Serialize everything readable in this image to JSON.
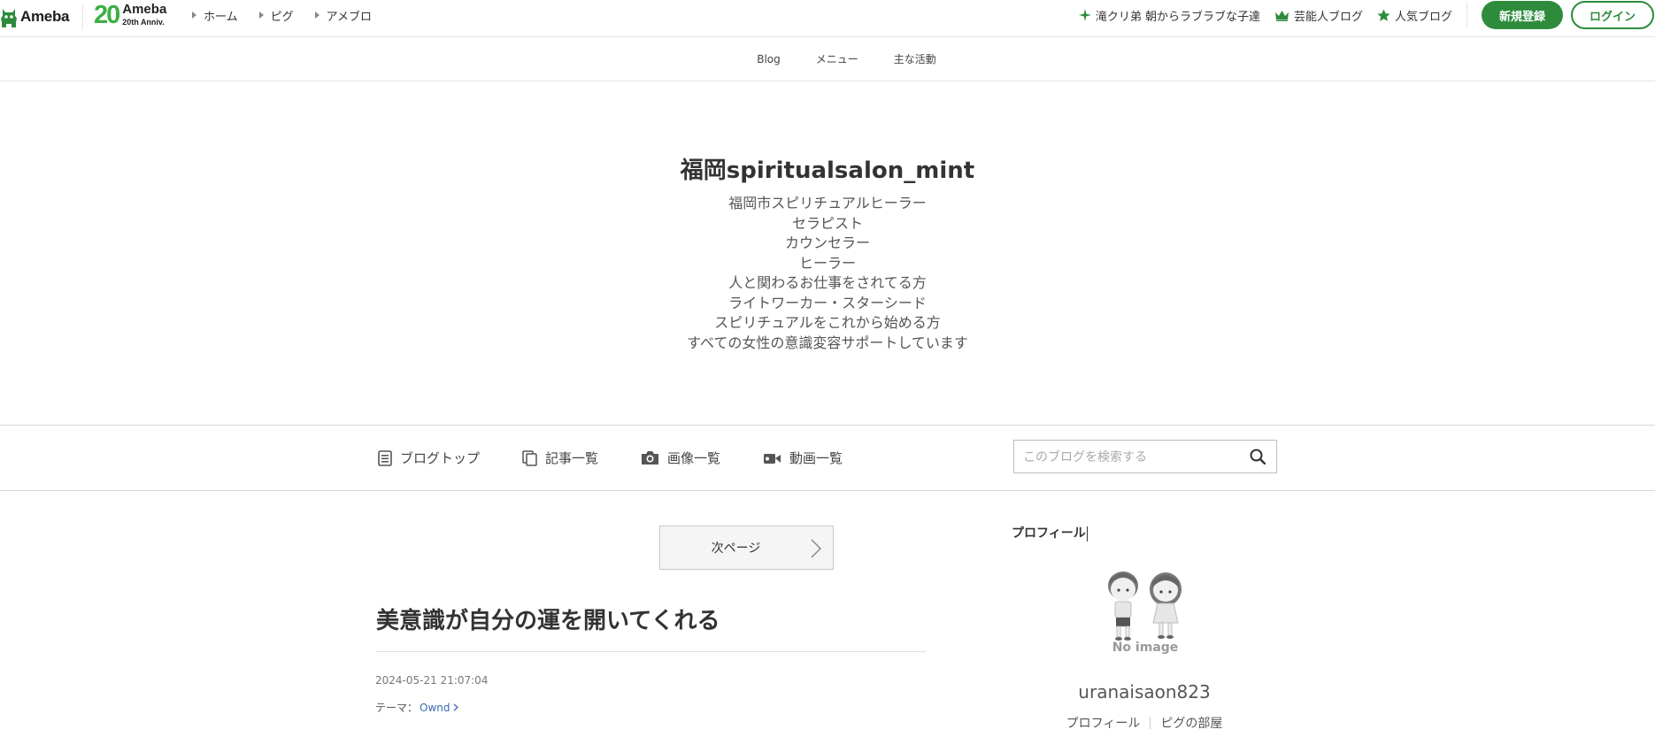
{
  "global_header": {
    "logo_text": "Ameba",
    "anniversary": {
      "number": "20",
      "brand": "Ameba",
      "label": "20th Anniv."
    },
    "nav": [
      {
        "label": "ホーム"
      },
      {
        "label": "ピグ"
      },
      {
        "label": "アメブロ"
      }
    ],
    "featured": [
      {
        "icon": "sparkle-icon",
        "label": "滝クリ弟 朝からラブラブな子達"
      },
      {
        "icon": "crown-icon",
        "label": "芸能人ブログ"
      },
      {
        "icon": "star-icon",
        "label": "人気ブログ"
      }
    ],
    "register_label": "新規登録",
    "login_label": "ログイン",
    "brand_color": "#2d8c3c"
  },
  "blog_nav": {
    "items": [
      {
        "label": "Blog"
      },
      {
        "label": "メニュー"
      },
      {
        "label": "主な活動"
      }
    ]
  },
  "blog_header": {
    "title": "福岡spiritualsalon_mint",
    "description": [
      "福岡市スピリチュアルヒーラー",
      "セラピスト",
      "カウンセラー",
      "ヒーラー",
      "人と関わるお仕事をされてる方",
      "ライトワーカー・スターシード",
      "スピリチュアルをこれから始める方",
      "すべての女性の意識変容サポートしています"
    ]
  },
  "blog_menu": {
    "items": [
      {
        "icon": "blog-top-icon",
        "label": "ブログトップ"
      },
      {
        "icon": "article-list-icon",
        "label": "記事一覧"
      },
      {
        "icon": "camera-icon",
        "label": "画像一覧"
      },
      {
        "icon": "video-camera-icon",
        "label": "動画一覧"
      }
    ],
    "search": {
      "placeholder": "このブログを検索する",
      "value": ""
    }
  },
  "main": {
    "next_page_label": "次ページ",
    "entry": {
      "title": "美意識が自分の運を開いてくれる",
      "date": "2024-05-21 21:07:04",
      "theme_prefix": "テーマ：",
      "theme_link": "Ownd"
    }
  },
  "sidebar": {
    "heading": "プロフィール",
    "avatar_text": "No image",
    "username": "uranaisaon823",
    "links": [
      {
        "label": "プロフィール"
      },
      {
        "label": "ピグの部屋"
      }
    ]
  }
}
